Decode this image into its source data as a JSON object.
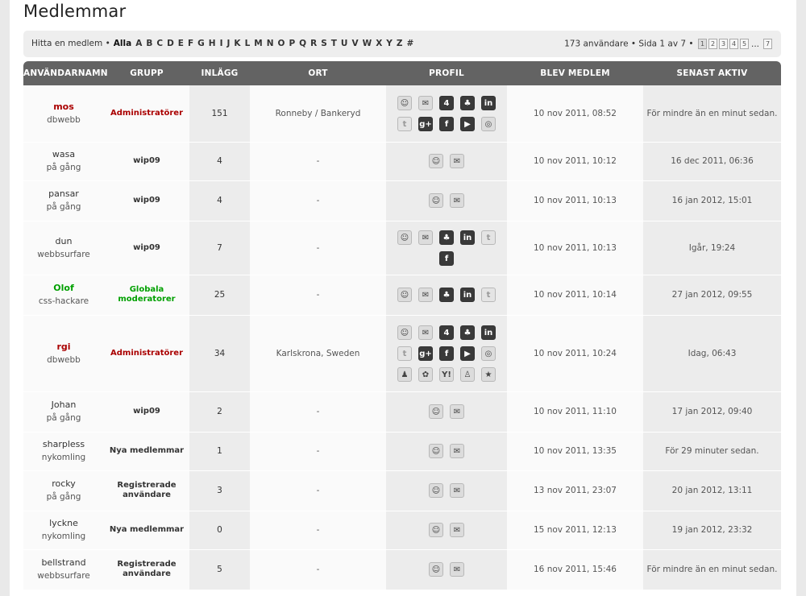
{
  "page": {
    "title": "Medlemmar"
  },
  "filter": {
    "label": "Hitta en medlem •",
    "letters": [
      "Alla",
      "A",
      "B",
      "C",
      "D",
      "E",
      "F",
      "G",
      "H",
      "I",
      "J",
      "K",
      "L",
      "M",
      "N",
      "O",
      "P",
      "Q",
      "R",
      "S",
      "T",
      "U",
      "V",
      "W",
      "X",
      "Y",
      "Z",
      "#"
    ],
    "selected": "Alla"
  },
  "pagination": {
    "summary": "173 användare • Sida 1 av 7 •",
    "pages": [
      "1",
      "2",
      "3",
      "4",
      "5"
    ],
    "ellipsis": "...",
    "last": "7",
    "current": "1"
  },
  "table": {
    "headers": [
      "ANVÄNDARNAMN",
      "GRUPP",
      "INLÄGG",
      "ORT",
      "PROFIL",
      "BLEV MEDLEM",
      "SENAST AKTIV"
    ],
    "rows": [
      {
        "name": "mos",
        "rank": "dbwebb",
        "name_style": "admin",
        "group": "Administratörer",
        "group_style": "admin",
        "posts": "151",
        "city": "Ronneby / Bankeryd",
        "joined": "10 nov 2011, 08:52",
        "active": "För mindre än en minut sedan.",
        "icons": [
          "profile",
          "email",
          "foursquare",
          "github",
          "linkedin",
          "twitter",
          "googleplus",
          "facebook",
          "youtube",
          "website"
        ]
      },
      {
        "name": "wasa",
        "rank": "på gång",
        "name_style": "normal",
        "group": "wip09",
        "group_style": "normal",
        "posts": "4",
        "city": "-",
        "joined": "10 nov 2011, 10:12",
        "active": "16 dec 2011, 06:36",
        "icons": [
          "profile",
          "email"
        ]
      },
      {
        "name": "pansar",
        "rank": "på gång",
        "name_style": "normal",
        "group": "wip09",
        "group_style": "normal",
        "posts": "4",
        "city": "-",
        "joined": "10 nov 2011, 10:13",
        "active": "16 jan 2012, 15:01",
        "icons": [
          "profile",
          "email"
        ]
      },
      {
        "name": "dun",
        "rank": "webbsurfare",
        "name_style": "normal",
        "group": "wip09",
        "group_style": "normal",
        "posts": "7",
        "city": "-",
        "joined": "10 nov 2011, 10:13",
        "active": "Igår, 19:24",
        "icons": [
          "profile",
          "email",
          "github",
          "linkedin",
          "twitter",
          "facebook"
        ]
      },
      {
        "name": "Olof",
        "rank": "css-hackare",
        "name_style": "mod",
        "group": "Globala moderatorer",
        "group_style": "mod",
        "posts": "25",
        "city": "-",
        "joined": "10 nov 2011, 10:14",
        "active": "27 jan 2012, 09:55",
        "icons": [
          "profile",
          "email",
          "github",
          "linkedin",
          "twitter"
        ]
      },
      {
        "name": "rgi",
        "rank": "dbwebb",
        "name_style": "admin",
        "group": "Administratörer",
        "group_style": "admin",
        "posts": "34",
        "city": "Karlskrona, Sweden",
        "joined": "10 nov 2011, 10:24",
        "active": "Idag, 06:43",
        "icons": [
          "profile",
          "email",
          "foursquare",
          "github",
          "linkedin",
          "twitter",
          "googleplus",
          "facebook",
          "youtube",
          "website",
          "msn",
          "icq",
          "yahoo",
          "aim",
          "star"
        ]
      },
      {
        "name": "Johan",
        "rank": "på gång",
        "name_style": "normal",
        "group": "wip09",
        "group_style": "normal",
        "posts": "2",
        "city": "-",
        "joined": "10 nov 2011, 11:10",
        "active": "17 jan 2012, 09:40",
        "icons": [
          "profile",
          "email"
        ]
      },
      {
        "name": "sharpless",
        "rank": "nykomling",
        "name_style": "normal",
        "group": "Nya medlemmar",
        "group_style": "normal",
        "posts": "1",
        "city": "-",
        "joined": "10 nov 2011, 13:35",
        "active": "För 29 minuter sedan.",
        "icons": [
          "profile",
          "email"
        ]
      },
      {
        "name": "rocky",
        "rank": "på gång",
        "name_style": "normal",
        "group": "Registrerade användare",
        "group_style": "normal",
        "posts": "3",
        "city": "-",
        "joined": "13 nov 2011, 23:07",
        "active": "20 jan 2012, 13:11",
        "icons": [
          "profile",
          "email"
        ]
      },
      {
        "name": "lyckne",
        "rank": "nykomling",
        "name_style": "normal",
        "group": "Nya medlemmar",
        "group_style": "normal",
        "posts": "0",
        "city": "-",
        "joined": "15 nov 2011, 12:13",
        "active": "19 jan 2012, 23:32",
        "icons": [
          "profile",
          "email"
        ]
      },
      {
        "name": "bellstrand",
        "rank": "webbsurfare",
        "name_style": "normal",
        "group": "Registrerade användare",
        "group_style": "normal",
        "posts": "5",
        "city": "-",
        "joined": "16 nov 2011, 15:46",
        "active": "För mindre än en minut sedan.",
        "icons": [
          "profile",
          "email"
        ]
      }
    ]
  },
  "icon_glyphs": {
    "profile": "☺",
    "email": "✉",
    "foursquare": "4",
    "github": "♣",
    "linkedin": "in",
    "twitter": "t",
    "googleplus": "g+",
    "facebook": "f",
    "youtube": "▶",
    "website": "◎",
    "msn": "♟",
    "icq": "✿",
    "yahoo": "Y!",
    "aim": "♙",
    "star": "★"
  }
}
